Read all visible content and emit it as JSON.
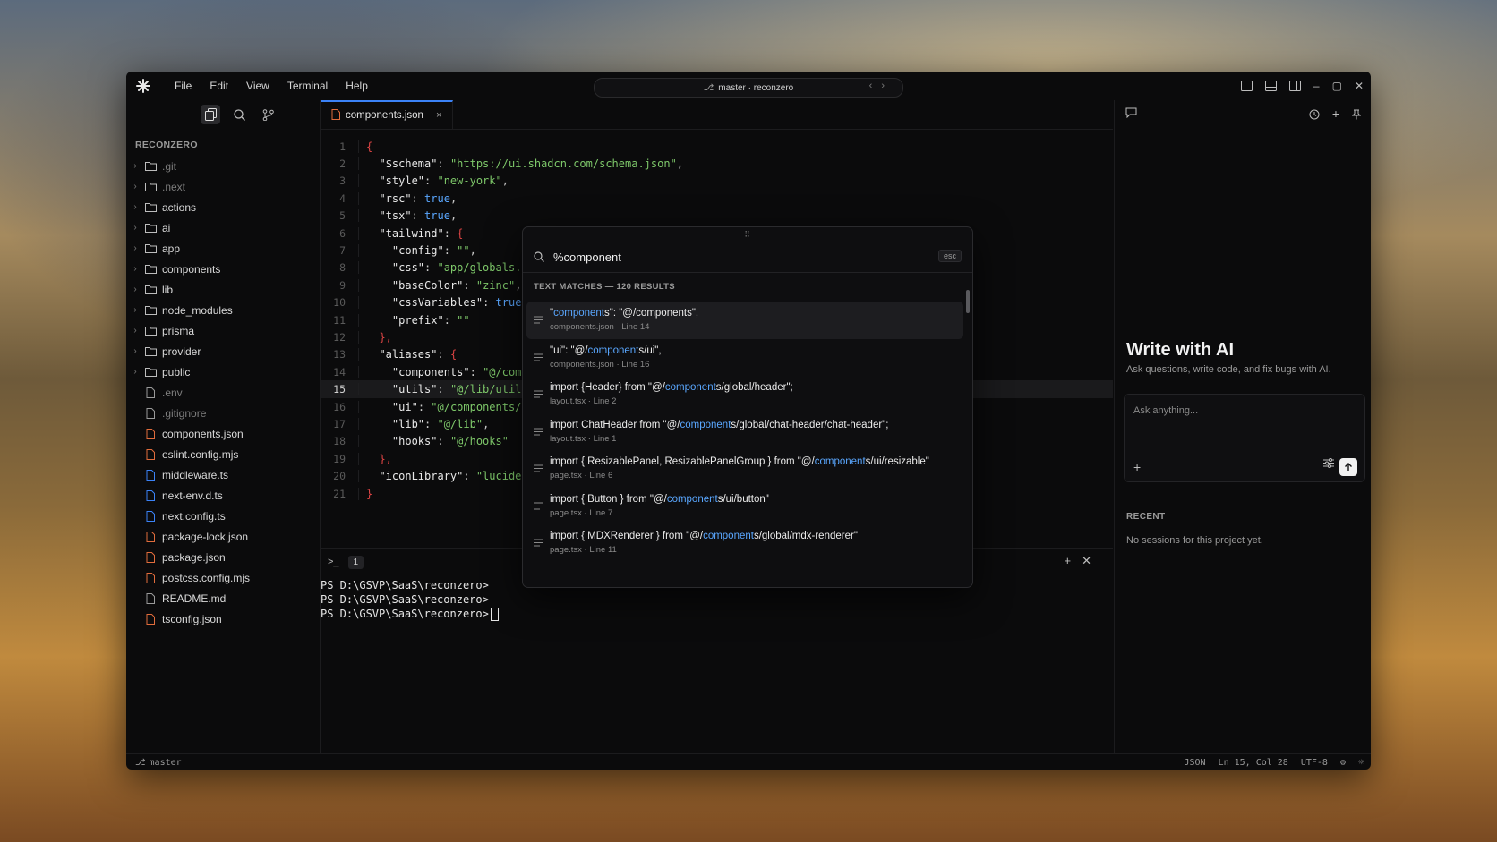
{
  "menu": [
    "File",
    "Edit",
    "View",
    "Terminal",
    "Help"
  ],
  "branch_pill": "master · reconzero",
  "explorer": {
    "title": "RECONZERO",
    "folders": [
      ".git",
      ".next",
      "actions",
      "ai",
      "app",
      "components",
      "lib",
      "node_modules",
      "prisma",
      "provider",
      "public"
    ],
    "files": [
      {
        "name": ".env",
        "color": "#9a9a9a"
      },
      {
        "name": ".gitignore",
        "color": "#9a9a9a"
      },
      {
        "name": "components.json",
        "color": "#e06c3c"
      },
      {
        "name": "eslint.config.mjs",
        "color": "#e06c3c"
      },
      {
        "name": "middleware.ts",
        "color": "#3b82f6"
      },
      {
        "name": "next-env.d.ts",
        "color": "#3b82f6"
      },
      {
        "name": "next.config.ts",
        "color": "#3b82f6"
      },
      {
        "name": "package-lock.json",
        "color": "#e06c3c"
      },
      {
        "name": "package.json",
        "color": "#e06c3c"
      },
      {
        "name": "postcss.config.mjs",
        "color": "#e06c3c"
      },
      {
        "name": "README.md",
        "color": "#9a9a9a"
      },
      {
        "name": "tsconfig.json",
        "color": "#e06c3c"
      }
    ]
  },
  "tab": {
    "label": "components.json",
    "close": "×"
  },
  "code_lines": [
    {
      "n": "1"
    },
    {
      "n": "2"
    },
    {
      "n": "3"
    },
    {
      "n": "4"
    },
    {
      "n": "5"
    },
    {
      "n": "6"
    },
    {
      "n": "7"
    },
    {
      "n": "8"
    },
    {
      "n": "9"
    },
    {
      "n": "10"
    },
    {
      "n": "11"
    },
    {
      "n": "12"
    },
    {
      "n": "13"
    },
    {
      "n": "14"
    },
    {
      "n": "15"
    },
    {
      "n": "16"
    },
    {
      "n": "17"
    },
    {
      "n": "18"
    },
    {
      "n": "19"
    },
    {
      "n": "20"
    },
    {
      "n": "21"
    }
  ],
  "code": {
    "l1": "{",
    "l2k": "\"$schema\"",
    "l2v": "\"https://ui.shadcn.com/schema.json\"",
    "l3k": "\"style\"",
    "l3v": "\"new-york\"",
    "l4k": "\"rsc\"",
    "l4v": "true",
    "l5k": "\"tsx\"",
    "l5v": "true",
    "l6k": "\"tailwind\"",
    "l7k": "\"config\"",
    "l7v": "\"\"",
    "l8k": "\"css\"",
    "l8v": "\"app/globals.cs",
    "l9k": "\"baseColor\"",
    "l9v": "\"zinc\"",
    "l10k": "\"cssVariables\"",
    "l10v": "true",
    "l11k": "\"prefix\"",
    "l11v": "\"\"",
    "l12": "},",
    "l13k": "\"aliases\"",
    "l14k": "\"components\"",
    "l14v": "\"@/compo",
    "l15k": "\"utils\"",
    "l15v": "\"@/lib/utils",
    "l16k": "\"ui\"",
    "l16v": "\"@/components/ui",
    "l17k": "\"lib\"",
    "l17v": "\"@/lib\"",
    "l18k": "\"hooks\"",
    "l18v": "\"@/hooks\"",
    "l19": "},",
    "l20k": "\"iconLibrary\"",
    "l20v": "\"lucide\"",
    "l21": "}"
  },
  "terminal": {
    "tab_number": "1",
    "lines": [
      "PS D:\\GSVP\\SaaS\\reconzero>",
      "PS D:\\GSVP\\SaaS\\reconzero>",
      "PS D:\\GSVP\\SaaS\\reconzero>"
    ]
  },
  "palette": {
    "query": "%component",
    "esc": "esc",
    "section_title": "TEXT MATCHES — 120 RESULTS",
    "results": [
      {
        "pre": "\"",
        "hl": "component",
        "post": "s\": \"@/components\",",
        "sub": "components.json · Line 14"
      },
      {
        "pre": "\"ui\": \"@/",
        "hl": "component",
        "post": "s/ui\",",
        "sub": "components.json · Line 16"
      },
      {
        "pre": "import {Header} from \"@/",
        "hl": "component",
        "post": "s/global/header\";",
        "sub": "layout.tsx · Line 2"
      },
      {
        "pre": "import ChatHeader from \"@/",
        "hl": "component",
        "post": "s/global/chat-header/chat-header\";",
        "sub": "layout.tsx · Line 1"
      },
      {
        "pre": "import { ResizablePanel, ResizablePanelGroup } from \"@/",
        "hl": "component",
        "post": "s/ui/resizable\"",
        "sub": "page.tsx · Line 6"
      },
      {
        "pre": "import { Button } from \"@/",
        "hl": "component",
        "post": "s/ui/button\"",
        "sub": "page.tsx · Line 7"
      },
      {
        "pre": "import { MDXRenderer } from \"@/",
        "hl": "component",
        "post": "s/global/mdx-renderer\"",
        "sub": "page.tsx · Line 11"
      }
    ]
  },
  "ai_panel": {
    "title": "Write with AI",
    "subtitle": "Ask questions, write code, and fix bugs with AI.",
    "placeholder": "Ask anything...",
    "recent_title": "RECENT",
    "no_sessions": "No sessions for this project yet."
  },
  "status": {
    "branch": "master",
    "language": "JSON",
    "position": "Ln 15, Col 28",
    "encoding": "UTF-8"
  },
  "colors": {
    "accent": "#3b82f6",
    "string": "#7ec86a",
    "keyword_blue": "#5aa7ff",
    "json_file": "#e06c3c",
    "ts_file": "#3b82f6"
  }
}
